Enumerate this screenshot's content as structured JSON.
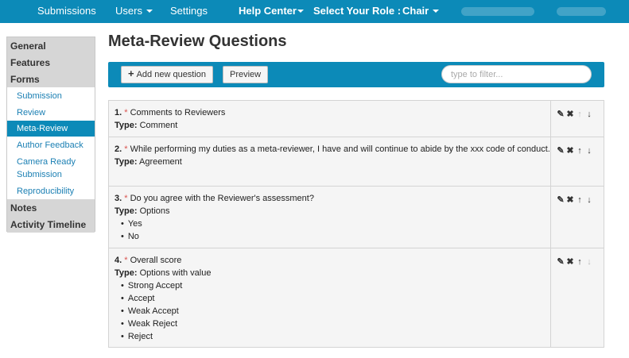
{
  "topnav": {
    "submissions": "Submissions",
    "users": "Users",
    "settings": "Settings",
    "help_center": "Help Center",
    "role_label": "Select Your Role :",
    "role_value": "Chair"
  },
  "sidebar": {
    "general": "General",
    "features": "Features",
    "forms": "Forms",
    "form_items": [
      "Submission",
      "Review",
      "Meta-Review",
      "Author Feedback",
      "Camera Ready Submission",
      "Reproducibility"
    ],
    "notes": "Notes",
    "activity": "Activity Timeline",
    "active_item": "Meta-Review"
  },
  "page": {
    "title": "Meta-Review Questions",
    "add_button": "Add new question",
    "preview_button": "Preview",
    "filter_placeholder": "type to filter...",
    "type_label": "Type:"
  },
  "questions": [
    {
      "num": "1.",
      "required": "*",
      "text": "Comments to Reviewers",
      "type": "Comment",
      "options": [],
      "up_enabled": false,
      "down_enabled": true
    },
    {
      "num": "2.",
      "required": "*",
      "text": "While performing my duties as a meta-reviewer, I have and will continue to abide by the xxx code of conduct.",
      "type": "Agreement",
      "options": [],
      "up_enabled": true,
      "down_enabled": true
    },
    {
      "num": "3.",
      "required": "*",
      "text": "Do you agree with the Reviewer's assessment?",
      "type": "Options",
      "options": [
        "Yes",
        "No"
      ],
      "up_enabled": true,
      "down_enabled": true
    },
    {
      "num": "4.",
      "required": "*",
      "text": "Overall score",
      "type": "Options with value",
      "options": [
        "Strong Accept",
        "Accept",
        "Weak Accept",
        "Weak Reject",
        "Reject"
      ],
      "up_enabled": true,
      "down_enabled": false
    }
  ],
  "icons": {
    "edit": "edit-icon",
    "delete": "delete-icon",
    "up": "arrow-up-icon",
    "down": "arrow-down-icon"
  },
  "colors": {
    "accent": "#0c8ab8",
    "required": "#d9534f"
  }
}
